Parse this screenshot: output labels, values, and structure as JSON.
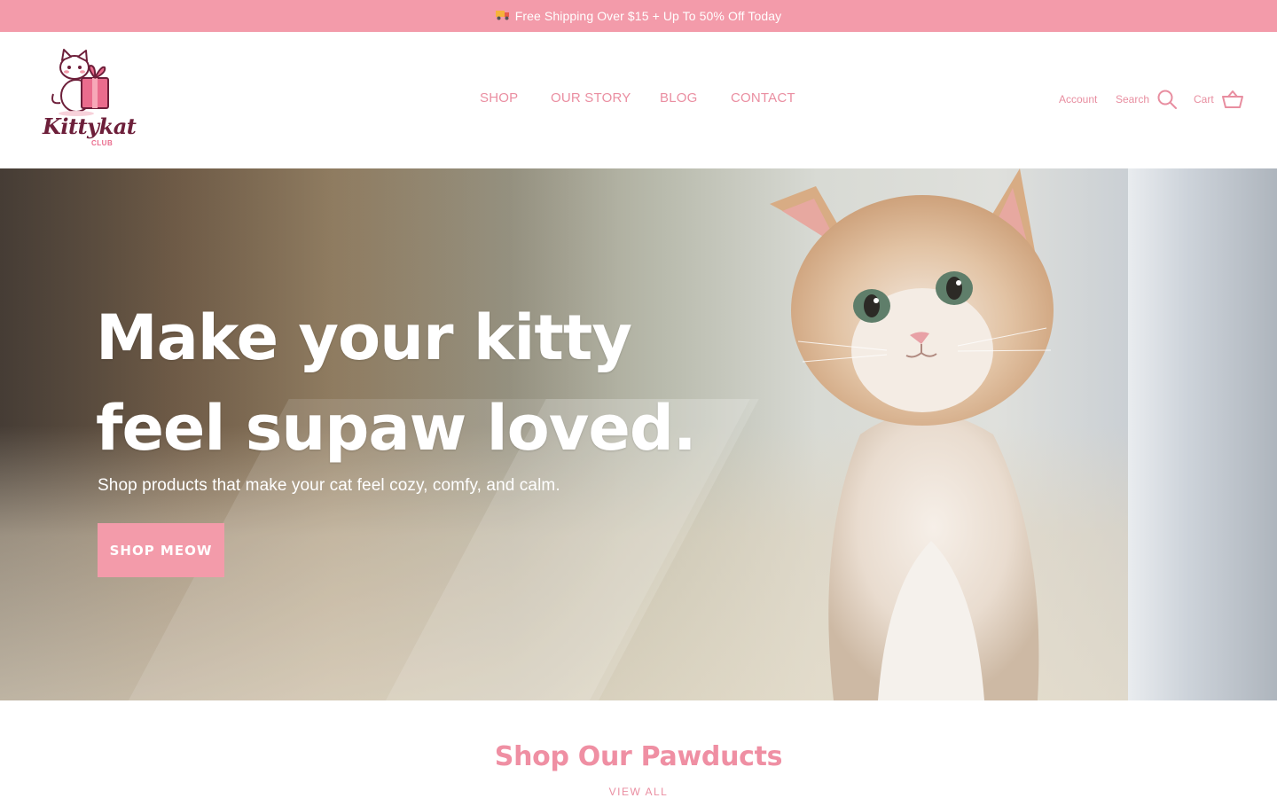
{
  "announcement": {
    "text": "Free Shipping Over $15 + Up To 50% Off Today",
    "icon": "truck-icon"
  },
  "brand": {
    "logo_word": "Kittykat",
    "logo_sub": "CLUB"
  },
  "nav": {
    "items": [
      {
        "label": "SHOP"
      },
      {
        "label": "OUR STORY"
      },
      {
        "label": "BLOG"
      },
      {
        "label": "CONTACT"
      }
    ]
  },
  "utility": {
    "account_label": "Account",
    "search_label": "Search",
    "cart_label": "Cart"
  },
  "hero": {
    "title_line1": "Make your kitty",
    "title_line2": "feel supaw loved.",
    "subtitle": "Shop products that make your cat feel cozy, comfy, and calm.",
    "button_label": "SHOP MEOW"
  },
  "products_section": {
    "title": "Shop Our Pawducts",
    "view_all_label": "VIEW ALL"
  },
  "colors": {
    "accent_pink": "#f39baa",
    "nav_pink": "#ea8ea1",
    "logo_maroon": "#6d1f3a"
  }
}
